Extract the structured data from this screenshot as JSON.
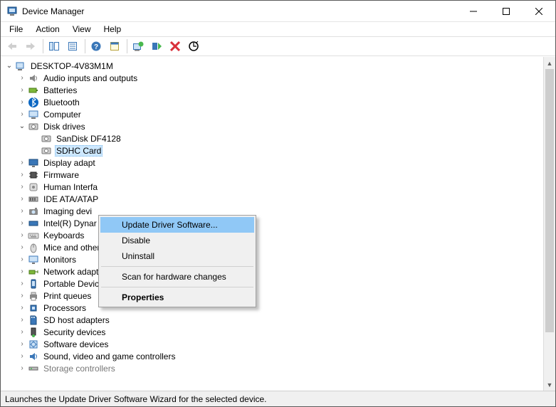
{
  "window": {
    "title": "Device Manager"
  },
  "menubar": [
    "File",
    "Action",
    "View",
    "Help"
  ],
  "toolbar_icons": [
    "back",
    "forward",
    "show-hide-console",
    "properties",
    "help",
    "view-toggle",
    "update-driver",
    "enable",
    "uninstall",
    "scan-hardware"
  ],
  "tree": {
    "root": "DESKTOP-4V83M1M",
    "categories": [
      {
        "label": "Audio inputs and outputs",
        "icon": "speaker"
      },
      {
        "label": "Batteries",
        "icon": "battery"
      },
      {
        "label": "Bluetooth",
        "icon": "bluetooth"
      },
      {
        "label": "Computer",
        "icon": "computer"
      },
      {
        "label": "Disk drives",
        "icon": "disk",
        "expanded": true,
        "children": [
          {
            "label": "SanDisk DF4128",
            "icon": "disk"
          },
          {
            "label": "SDHC Card",
            "icon": "disk",
            "selected": true
          }
        ]
      },
      {
        "label": "Display adapt",
        "icon": "display",
        "truncated": true
      },
      {
        "label": "Firmware",
        "icon": "chip"
      },
      {
        "label": "Human Interfa",
        "icon": "hid",
        "truncated": true
      },
      {
        "label": "IDE ATA/ATAP",
        "icon": "ide",
        "truncated": true
      },
      {
        "label": "Imaging devi",
        "icon": "camera",
        "truncated": true
      },
      {
        "label": "Intel(R) Dynar",
        "icon": "intel",
        "truncated": true
      },
      {
        "label": "Keyboards",
        "icon": "keyboard"
      },
      {
        "label": "Mice and other pointing devices",
        "icon": "mouse"
      },
      {
        "label": "Monitors",
        "icon": "monitor"
      },
      {
        "label": "Network adapters",
        "icon": "network"
      },
      {
        "label": "Portable Devices",
        "icon": "portable"
      },
      {
        "label": "Print queues",
        "icon": "printer"
      },
      {
        "label": "Processors",
        "icon": "cpu"
      },
      {
        "label": "SD host adapters",
        "icon": "sd"
      },
      {
        "label": "Security devices",
        "icon": "security"
      },
      {
        "label": "Software devices",
        "icon": "software"
      },
      {
        "label": "Sound, video and game controllers",
        "icon": "sound"
      },
      {
        "label": "Storage controllers",
        "icon": "storage",
        "faded": true
      }
    ]
  },
  "context_menu": {
    "items": [
      {
        "label": "Update Driver Software...",
        "highlighted": true
      },
      {
        "label": "Disable"
      },
      {
        "label": "Uninstall"
      },
      {
        "separator": true
      },
      {
        "label": "Scan for hardware changes"
      },
      {
        "separator": true
      },
      {
        "label": "Properties",
        "bold": true
      }
    ]
  },
  "statusbar": "Launches the Update Driver Software Wizard for the selected device."
}
